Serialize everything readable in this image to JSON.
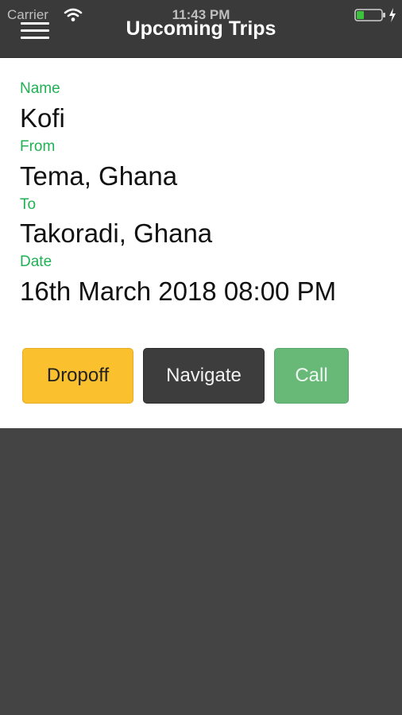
{
  "status_bar": {
    "carrier": "Carrier",
    "time": "11:43 PM",
    "icons": [
      "wifi-icon",
      "battery-icon",
      "charging-icon"
    ]
  },
  "header": {
    "title": "Upcoming Trips",
    "menu_icon": "hamburger-menu-icon"
  },
  "trip": {
    "name_label": "Name",
    "name": "Kofi",
    "from_label": "From",
    "from": "Tema, Ghana",
    "to_label": "To",
    "to": "Takoradi, Ghana",
    "date_label": "Date",
    "date": "16th March 2018 08:00 PM"
  },
  "actions": {
    "dropoff": "Dropoff",
    "navigate": "Navigate",
    "call": "Call"
  },
  "colors": {
    "label_green": "#1fb154",
    "dropoff_yellow": "#fbc02d",
    "navigate_dark": "#3d3d3d",
    "call_green": "#68b878",
    "background": "#444444"
  }
}
